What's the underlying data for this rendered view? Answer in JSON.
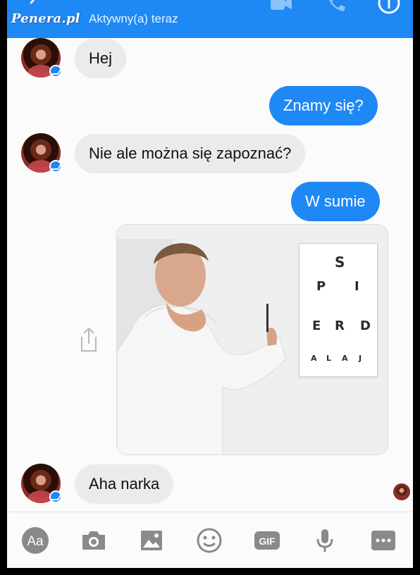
{
  "header": {
    "watermark": "Penera.pl",
    "status": "Aktywny(a) teraz",
    "icons": [
      "back-arrow-icon",
      "video-call-icon",
      "phone-icon",
      "info-icon"
    ]
  },
  "messages": [
    {
      "side": "in",
      "text": "Hej"
    },
    {
      "side": "out",
      "text": "Znamy się?"
    },
    {
      "side": "in",
      "text": "Nie ale można się zapoznać?"
    },
    {
      "side": "out",
      "text": "W sumie"
    },
    {
      "side": "out",
      "type": "image"
    },
    {
      "side": "in",
      "text": "Aha narka"
    }
  ],
  "eye_chart": {
    "rows": [
      [
        "S"
      ],
      [
        "P",
        "I"
      ],
      [
        "E",
        "R",
        "D"
      ],
      [
        "A",
        "L",
        "A",
        "J"
      ]
    ]
  },
  "toolbar": {
    "aa_label": "Aa",
    "gif_label": "GIF",
    "icons": [
      "text-aa-icon",
      "camera-icon",
      "gallery-icon",
      "emoji-icon",
      "gif-icon",
      "microphone-icon",
      "more-icon"
    ]
  },
  "colors": {
    "accent": "#1e88f5",
    "incoming_bubble": "#ebebed",
    "toolbar_icon": "#8a8a8a"
  }
}
